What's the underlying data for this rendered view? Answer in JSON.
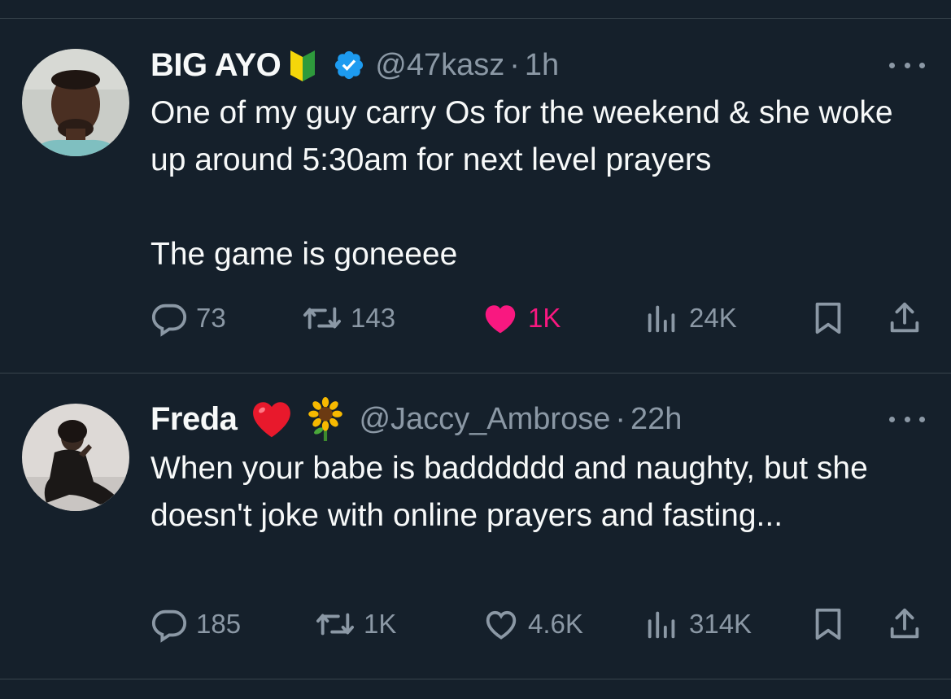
{
  "tweets": [
    {
      "name": "BIG AYO",
      "handle": "@47kasz",
      "separator": "·",
      "time": "1h",
      "text": "One of my guy carry Os for the weekend & she woke up around 5:30am for next level prayers\n\nThe game is goneeee",
      "replies": "73",
      "retweets": "143",
      "likes": "1K",
      "views": "24K",
      "liked": true,
      "badges": [
        "beginner-badge-icon",
        "verified-badge-icon"
      ]
    },
    {
      "name": "Freda",
      "handle": "@Jaccy_Ambrose",
      "separator": "·",
      "time": "22h",
      "text": "When your babe is badddddd and naughty, but she doesn't joke with online prayers and fasting...",
      "replies": "185",
      "retweets": "1K",
      "likes": "4.6K",
      "views": "314K",
      "liked": false,
      "badges": [
        "red-heart-emoji-icon",
        "sunflower-emoji-icon"
      ]
    }
  ],
  "colors": {
    "background": "#15202b",
    "text": "#f7f9f9",
    "muted": "#8b98a5",
    "like": "#f91880",
    "verified": "#1d9bf0",
    "divider": "#38444d"
  }
}
